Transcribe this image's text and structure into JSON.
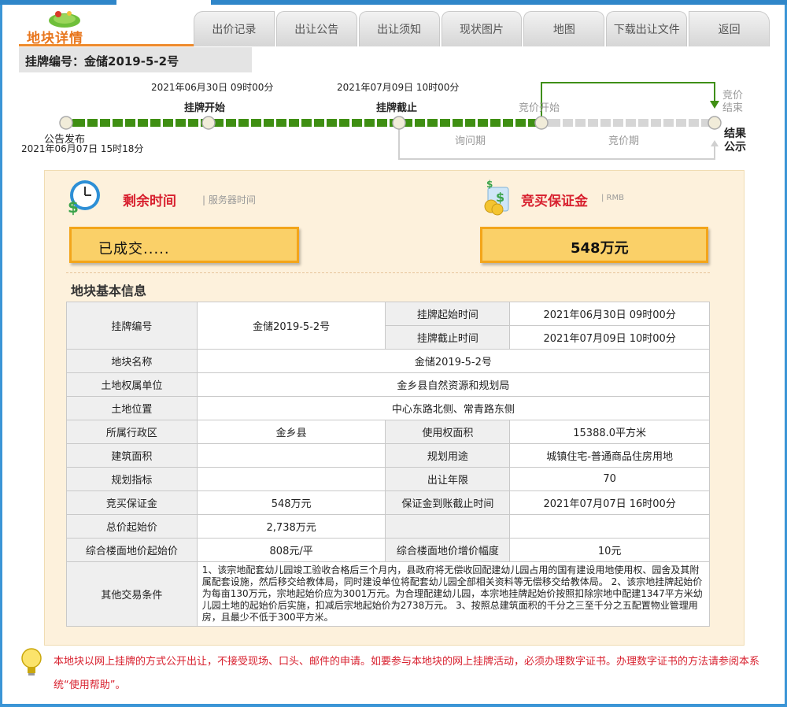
{
  "header": {
    "logo_text": "地块详情",
    "tabs": [
      "出价记录",
      "出让公告",
      "出让须知",
      "现状图片",
      "地图",
      "下载出让文件",
      "返回"
    ],
    "listing_no": "挂牌编号：金储2019-5-2号"
  },
  "timeline": {
    "announce_label": "公告发布",
    "announce_time": "2021年06月07日 15时18分",
    "start_time": "2021年06月30日 09时00分",
    "start_label": "挂牌开始",
    "end_time": "2021年07月09日 10时00分",
    "end_label": "挂牌截止",
    "bid_start_label": "竞价开始",
    "bid_end_label": "竞价结束",
    "inquiry_label": "询问期",
    "bidding_label": "竞价期",
    "result_label": "结果公示",
    "colors": {
      "active": "#3f8f13",
      "inactive": "#d6d6d6"
    }
  },
  "status": {
    "remaining_title": "剩余时间",
    "remaining_sub": "| 服务器时间",
    "remaining_value": "已成交.....",
    "deposit_title": "竞买保证金",
    "deposit_sub": "| RMB",
    "deposit_value": "548万元"
  },
  "info": {
    "title": "地块基本信息",
    "rows": {
      "listing_no_label": "挂牌编号",
      "listing_no_value": "金储2019-5-2号",
      "start_label": "挂牌起始时间",
      "start_value": "2021年06月30日 09时00分",
      "end_label": "挂牌截止时间",
      "end_value": "2021年07月09日 10时00分",
      "land_name_label": "地块名称",
      "land_name_value": "金储2019-5-2号",
      "owner_label": "土地权属单位",
      "owner_value": "金乡县自然资源和规划局",
      "location_label": "土地位置",
      "location_value": "中心东路北侧、常青路东侧",
      "district_label": "所属行政区",
      "district_value": "金乡县",
      "area_label": "使用权面积",
      "area_value": "15388.0平方米",
      "build_area_label": "建筑面积",
      "build_area_value": "",
      "usage_label": "规划用途",
      "usage_value": "城镇住宅-普通商品住房用地",
      "index_label": "规划指标",
      "index_value": "",
      "term_label": "出让年限",
      "term_value": "70",
      "deposit_label": "竞买保证金",
      "deposit_value": "548万元",
      "deposit_deadline_label": "保证金到账截止时间",
      "deposit_deadline_value": "2021年07月07日 16时00分",
      "total_price_label": "总价起始价",
      "total_price_value": "2,738万元",
      "floor_price_label": "综合楼面地价起始价",
      "floor_price_value": "808元/平",
      "increment_label": "综合楼面地价增价幅度",
      "increment_value": "10元",
      "conditions_label": "其他交易条件",
      "conditions_value": "1、该宗地配套幼儿园竣工验收合格后三个月内，县政府将无偿收回配建幼儿园占用的国有建设用地使用权、园舍及其附属配套设施，然后移交给教体局，同时建设单位将配套幼儿园全部相关资料等无偿移交给教体局。 2、该宗地挂牌起始价为每亩130万元，宗地起始价应为3001万元。为合理配建幼儿园，本宗地挂牌起始价按照扣除宗地中配建1347平方米幼儿园土地的起始价后实施，扣减后宗地起始价为2738万元。 3、按照总建筑面积的千分之三至千分之五配置物业管理用房，且最少不低于300平方米。"
    }
  },
  "notice": "本地块以网上挂牌的方式公开出让，不接受现场、口头、邮件的申请。如要参与本地块的网上挂牌活动，必须办理数字证书。办理数字证书的方法请参阅本系统“使用帮助”。"
}
